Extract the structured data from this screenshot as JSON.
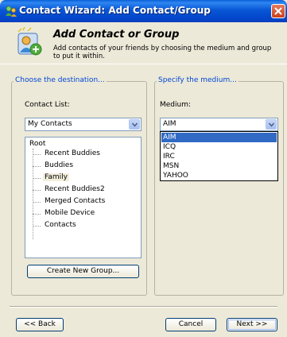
{
  "window": {
    "title": "Contact Wizard: Add Contact/Group"
  },
  "header": {
    "title": "Add Contact or Group",
    "subtitle": "Add contacts of your friends by choosing the medium and group to put it within."
  },
  "destination": {
    "legend": "Choose the destination...",
    "contact_list_label": "Contact List:",
    "contact_list_value": "My Contacts",
    "tree": {
      "root": "Root",
      "items": [
        {
          "label": "Recent Buddies",
          "selected": false
        },
        {
          "label": "Buddies",
          "selected": false
        },
        {
          "label": "Family",
          "selected": true
        },
        {
          "label": "Recent Buddies2",
          "selected": false
        },
        {
          "label": "Merged Contacts",
          "selected": false
        },
        {
          "label": "Mobile Device",
          "selected": false
        },
        {
          "label": "Contacts",
          "selected": false
        }
      ]
    },
    "create_group_label": "Create New Group..."
  },
  "medium": {
    "legend": "Specify the medium...",
    "medium_label": "Medium:",
    "medium_value": "AIM",
    "options": [
      "AIM",
      "ICQ",
      "IRC",
      "MSN",
      "YAHOO"
    ],
    "selected_option": "AIM"
  },
  "footer": {
    "back_label": "<< Back",
    "cancel_label": "Cancel",
    "next_label": "Next >>"
  },
  "colors": {
    "accent": "#0046d5",
    "title_bar": "#0856d6",
    "selection": "#316ac5"
  }
}
